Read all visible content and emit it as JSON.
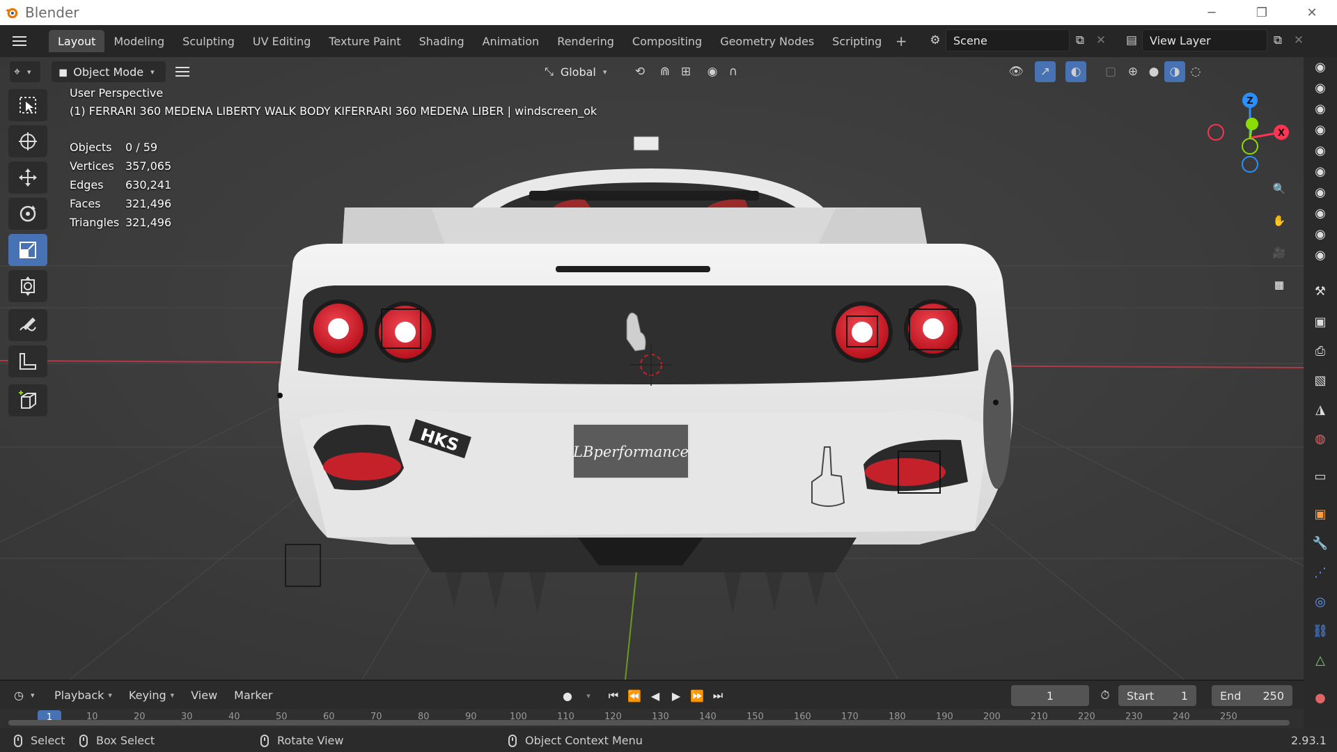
{
  "window": {
    "title": "Blender",
    "buttons": [
      "─",
      "❐",
      "✕"
    ]
  },
  "workspace_tabs": [
    {
      "label": "Layout",
      "active": true
    },
    {
      "label": "Modeling"
    },
    {
      "label": "Sculpting"
    },
    {
      "label": "UV Editing"
    },
    {
      "label": "Texture Paint"
    },
    {
      "label": "Shading"
    },
    {
      "label": "Animation"
    },
    {
      "label": "Rendering"
    },
    {
      "label": "Compositing"
    },
    {
      "label": "Geometry Nodes"
    },
    {
      "label": "Scripting"
    }
  ],
  "add_tab_label": "+",
  "scene": {
    "label": "Scene"
  },
  "view_layer": {
    "label": "View Layer"
  },
  "viewport_header": {
    "mode": "Object Mode",
    "transform_orientation": "Global"
  },
  "overlay": {
    "perspective": "User Perspective",
    "active_object": "(1) FERRARI 360 MEDENA LIBERTY WALK BODY KIFERRARI 360 MEDENA LIBER | windscreen_ok"
  },
  "stats": [
    {
      "key": "Objects",
      "value": "0 / 59"
    },
    {
      "key": "Vertices",
      "value": "357,065"
    },
    {
      "key": "Edges",
      "value": "630,241"
    },
    {
      "key": "Faces",
      "value": "321,496"
    },
    {
      "key": "Triangles",
      "value": "321,496"
    }
  ],
  "gizmo": {
    "z": "Z",
    "x": "X"
  },
  "car": {
    "plate_text": "LBperformance",
    "decal": "HKS"
  },
  "timeline": {
    "menus": [
      "Playback",
      "Keying",
      "View",
      "Marker"
    ],
    "current_frame": "1",
    "start_label": "Start",
    "start_value": "1",
    "end_label": "End",
    "end_value": "250",
    "playhead": "1",
    "ruler": [
      "10",
      "20",
      "30",
      "40",
      "50",
      "60",
      "70",
      "80",
      "90",
      "100",
      "110",
      "120",
      "130",
      "140",
      "150",
      "160",
      "170",
      "180",
      "190",
      "200",
      "210",
      "220",
      "230",
      "240",
      "250"
    ]
  },
  "statusbar": {
    "select": "Select",
    "box_select": "Box Select",
    "rotate_view": "Rotate View",
    "context_menu": "Object Context Menu",
    "version": "2.93.1"
  },
  "colors": {
    "accent": "#4772b3",
    "axis_x": "#ff3352",
    "axis_y": "#8bdc00",
    "axis_z": "#2890ff",
    "car_body": "#ececec",
    "tail_light": "#d81e2a"
  }
}
